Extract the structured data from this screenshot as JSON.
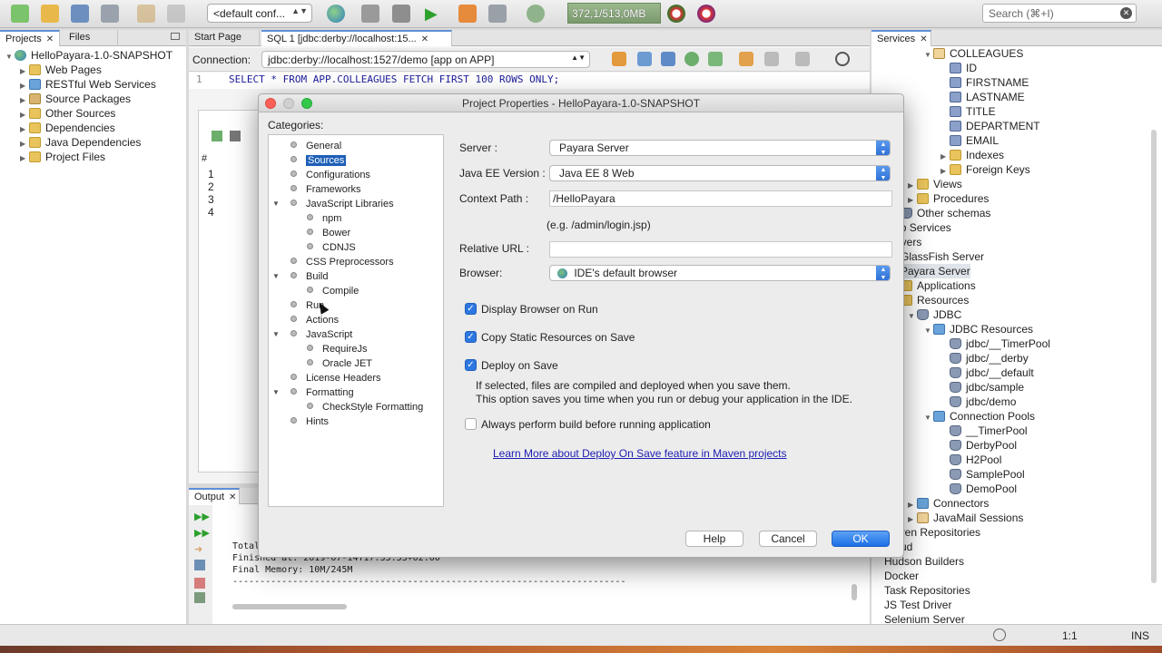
{
  "toolbar": {
    "config_combo": "<default conf...",
    "memory": "372,1/513,0MB",
    "search_placeholder": "Search (⌘+I)"
  },
  "projects_panel": {
    "tabs": [
      "Projects",
      "Files"
    ],
    "root": "HelloPayara-1.0-SNAPSHOT",
    "items": [
      "Web Pages",
      "RESTful Web Services",
      "Source Packages",
      "Other Sources",
      "Dependencies",
      "Java Dependencies",
      "Project Files"
    ]
  },
  "editor": {
    "tabs": [
      "Start Page",
      "SQL 1 [jdbc:derby://localhost:15..."
    ],
    "connection_label": "Connection:",
    "connection_value": "jdbc:derby://localhost:1527/demo [app on APP]",
    "line_number": "1",
    "sql": "SELECT * FROM APP.COLLEAGUES FETCH FIRST 100 ROWS ONLY;",
    "result_header": "#",
    "result_rows": [
      "1",
      "2",
      "3",
      "4"
    ]
  },
  "output": {
    "tab": "Output",
    "lines": [
      "Total",
      "Finished at: 2019-07-14T17:35:53+02:00",
      "Final Memory: 10M/245M",
      "------------------------------------------------------------------------"
    ]
  },
  "services": {
    "tab": "Services",
    "items": [
      {
        "label": "COLLEAGUES",
        "icon": "tbl",
        "indent": 3,
        "tri": "▼"
      },
      {
        "label": "ID",
        "icon": "col",
        "indent": 4,
        "tri": ""
      },
      {
        "label": "FIRSTNAME",
        "icon": "col",
        "indent": 4,
        "tri": ""
      },
      {
        "label": "LASTNAME",
        "icon": "col",
        "indent": 4,
        "tri": ""
      },
      {
        "label": "TITLE",
        "icon": "col",
        "indent": 4,
        "tri": ""
      },
      {
        "label": "DEPARTMENT",
        "icon": "col",
        "indent": 4,
        "tri": ""
      },
      {
        "label": "EMAIL",
        "icon": "col",
        "indent": 4,
        "tri": ""
      },
      {
        "label": "Indexes",
        "icon": "folder",
        "indent": 4,
        "tri": "▶"
      },
      {
        "label": "Foreign Keys",
        "icon": "folder",
        "indent": 4,
        "tri": "▶"
      },
      {
        "label": "Views",
        "icon": "folder",
        "indent": 2,
        "tri": "▶"
      },
      {
        "label": "Procedures",
        "icon": "folder",
        "indent": 2,
        "tri": "▶"
      },
      {
        "label": "Other schemas",
        "icon": "db",
        "indent": 1,
        "tri": "▶"
      },
      {
        "label": "Web Services",
        "icon": "",
        "indent": 0,
        "tri": ""
      },
      {
        "label": "Servers",
        "icon": "",
        "indent": 0,
        "tri": ""
      },
      {
        "label": "GlassFish Server",
        "icon": "srv",
        "indent": 0,
        "tri": ""
      },
      {
        "label": "Payara Server",
        "icon": "srv",
        "indent": 0,
        "tri": ""
      },
      {
        "label": "Applications",
        "icon": "folder",
        "indent": 1,
        "tri": "▶"
      },
      {
        "label": "Resources",
        "icon": "folder",
        "indent": 1,
        "tri": "▼"
      },
      {
        "label": "JDBC",
        "icon": "db",
        "indent": 2,
        "tri": "▼"
      },
      {
        "label": "JDBC Resources",
        "icon": "blue",
        "indent": 3,
        "tri": "▼"
      },
      {
        "label": "jdbc/__TimerPool",
        "icon": "db",
        "indent": 4,
        "tri": ""
      },
      {
        "label": "jdbc/__derby",
        "icon": "db",
        "indent": 4,
        "tri": ""
      },
      {
        "label": "jdbc/__default",
        "icon": "db",
        "indent": 4,
        "tri": ""
      },
      {
        "label": "jdbc/sample",
        "icon": "db",
        "indent": 4,
        "tri": ""
      },
      {
        "label": "jdbc/demo",
        "icon": "db",
        "indent": 4,
        "tri": ""
      },
      {
        "label": "Connection Pools",
        "icon": "blue",
        "indent": 3,
        "tri": "▼"
      },
      {
        "label": "__TimerPool",
        "icon": "db",
        "indent": 4,
        "tri": ""
      },
      {
        "label": "DerbyPool",
        "icon": "db",
        "indent": 4,
        "tri": ""
      },
      {
        "label": "H2Pool",
        "icon": "db",
        "indent": 4,
        "tri": ""
      },
      {
        "label": "SamplePool",
        "icon": "db",
        "indent": 4,
        "tri": ""
      },
      {
        "label": "DemoPool",
        "icon": "db",
        "indent": 4,
        "tri": ""
      },
      {
        "label": "Connectors",
        "icon": "blue",
        "indent": 2,
        "tri": "▶"
      },
      {
        "label": "JavaMail Sessions",
        "icon": "tbl",
        "indent": 2,
        "tri": "▶"
      },
      {
        "label": "Maven Repositories",
        "icon": "",
        "indent": 0,
        "tri": ""
      },
      {
        "label": "Cloud",
        "icon": "",
        "indent": 0,
        "tri": ""
      },
      {
        "label": "Hudson Builders",
        "icon": "",
        "indent": 0,
        "tri": ""
      },
      {
        "label": "Docker",
        "icon": "",
        "indent": 0,
        "tri": ""
      },
      {
        "label": "Task Repositories",
        "icon": "",
        "indent": 0,
        "tri": ""
      },
      {
        "label": "JS Test Driver",
        "icon": "",
        "indent": 0,
        "tri": ""
      },
      {
        "label": "Selenium Server",
        "icon": "",
        "indent": 0,
        "tri": ""
      }
    ]
  },
  "status_bar": {
    "position": "1:1",
    "mode": "INS"
  },
  "dialog": {
    "title": "Project Properties - HelloPayara-1.0-SNAPSHOT",
    "categories_label": "Categories:",
    "categories": [
      {
        "label": "General",
        "level": 0,
        "tri": ""
      },
      {
        "label": "Sources",
        "level": 0,
        "tri": "",
        "selected": true
      },
      {
        "label": "Configurations",
        "level": 0,
        "tri": ""
      },
      {
        "label": "Frameworks",
        "level": 0,
        "tri": ""
      },
      {
        "label": "JavaScript Libraries",
        "level": 0,
        "tri": "▼"
      },
      {
        "label": "npm",
        "level": 1,
        "tri": ""
      },
      {
        "label": "Bower",
        "level": 1,
        "tri": ""
      },
      {
        "label": "CDNJS",
        "level": 1,
        "tri": ""
      },
      {
        "label": "CSS Preprocessors",
        "level": 0,
        "tri": ""
      },
      {
        "label": "Build",
        "level": 0,
        "tri": "▼"
      },
      {
        "label": "Compile",
        "level": 1,
        "tri": ""
      },
      {
        "label": "Run",
        "level": 0,
        "tri": ""
      },
      {
        "label": "Actions",
        "level": 0,
        "tri": ""
      },
      {
        "label": "JavaScript",
        "level": 0,
        "tri": "▼"
      },
      {
        "label": "RequireJs",
        "level": 1,
        "tri": ""
      },
      {
        "label": "Oracle JET",
        "level": 1,
        "tri": ""
      },
      {
        "label": "License Headers",
        "level": 0,
        "tri": ""
      },
      {
        "label": "Formatting",
        "level": 0,
        "tri": "▼"
      },
      {
        "label": "CheckStyle Formatting",
        "level": 1,
        "tri": ""
      },
      {
        "label": "Hints",
        "level": 0,
        "tri": ""
      }
    ],
    "server_label": "Server :",
    "server_value": "Payara Server",
    "javaee_label": "Java EE Version :",
    "javaee_value": "Java EE 8 Web",
    "context_label": "Context Path :",
    "context_value": "/HelloPayara",
    "context_hint": "(e.g. /admin/login.jsp)",
    "relative_label": "Relative URL :",
    "relative_value": "",
    "browser_label": "Browser:",
    "browser_value": "IDE's default browser",
    "cb_display": "Display Browser on Run",
    "cb_copy": "Copy Static Resources on Save",
    "cb_deploy": "Deploy on Save",
    "deploy_desc_1": "If selected, files are compiled and deployed when you save them.",
    "deploy_desc_2": "This option saves you time when you run or debug your application in the IDE.",
    "cb_always": "Always perform build before running application",
    "link": "Learn More about Deploy On Save feature in Maven projects",
    "btn_help": "Help",
    "btn_cancel": "Cancel",
    "btn_ok": "OK"
  },
  "colors": {
    "accent": "#1d5fb8",
    "ok_button": "#1b6fe6",
    "link": "#1d1db3"
  }
}
